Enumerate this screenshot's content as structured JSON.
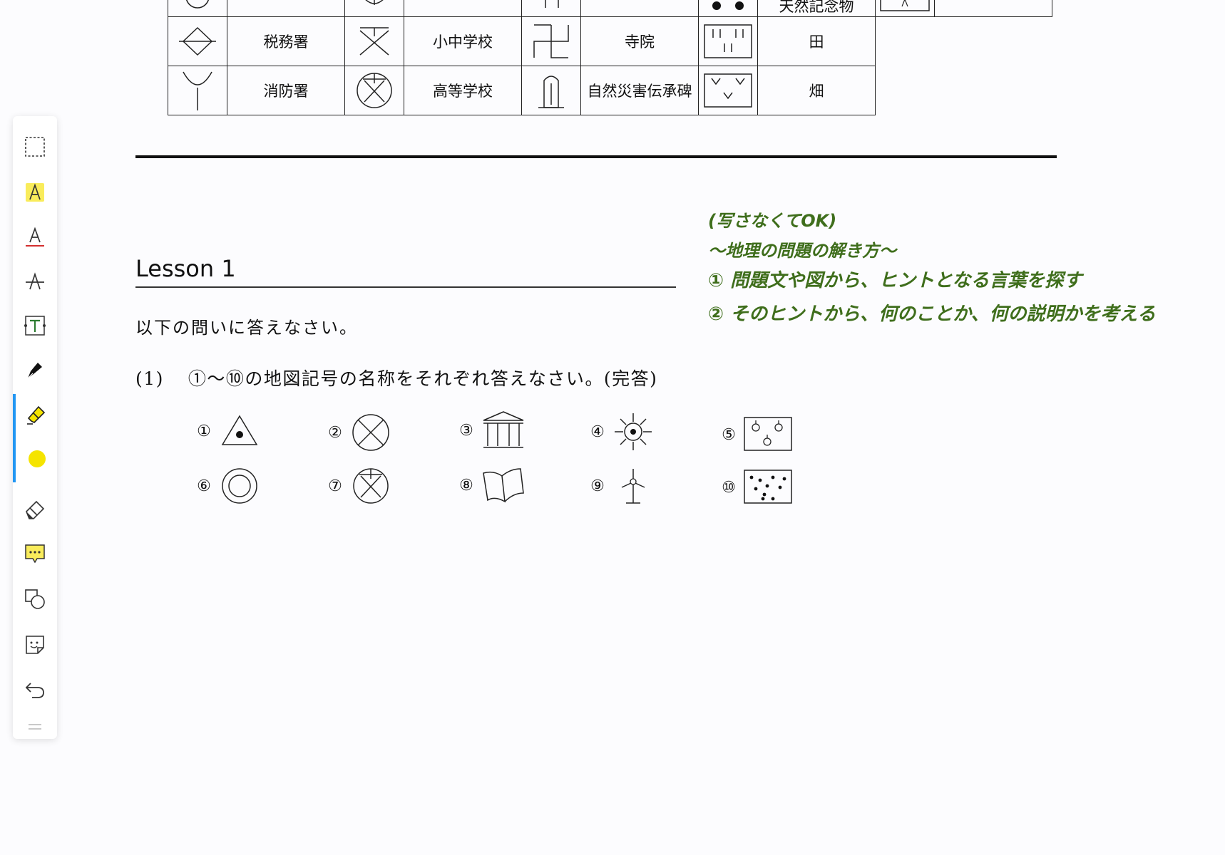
{
  "table": {
    "top_row": [
      "",
      "",
      "",
      "天然記念物",
      ""
    ],
    "rows": [
      {
        "names": [
          "税務署",
          "小中学校",
          "寺院",
          "田"
        ]
      },
      {
        "names": [
          "消防署",
          "高等学校",
          "自然災害伝承碑",
          "畑"
        ]
      }
    ]
  },
  "lesson": {
    "title": "Lesson 1",
    "instruction": "以下の問いに答えなさい。",
    "question_number": "(1)",
    "question_text": "①～⑩の地図記号の名称をそれぞれ答えなさい。(完答)"
  },
  "symbols": [
    {
      "num": "①",
      "icon": "triangle-dot-icon"
    },
    {
      "num": "②",
      "icon": "circle-x-icon"
    },
    {
      "num": "③",
      "icon": "museum-icon"
    },
    {
      "num": "④",
      "icon": "sun-rays-icon"
    },
    {
      "num": "⑤",
      "icon": "orchard-icon"
    },
    {
      "num": "⑥",
      "icon": "double-circle-icon"
    },
    {
      "num": "⑦",
      "icon": "circle-x-bar-icon"
    },
    {
      "num": "⑧",
      "icon": "open-book-icon"
    },
    {
      "num": "⑨",
      "icon": "windmill-icon"
    },
    {
      "num": "⑩",
      "icon": "dots-field-icon"
    }
  ],
  "notes": {
    "line1": "(写さなくてOK)",
    "line2": "～地理の問題の解き方～",
    "line3": "① 問題文や図から、ヒントとなる言葉を探す",
    "line4": "② そのヒントから、何のことか、何の説明かを考える",
    "color": "#3f6e1c"
  },
  "toolbar": {
    "tools": [
      "lasso-select-icon",
      "highlight-text-icon",
      "underline-text-icon",
      "strikethrough-text-icon",
      "text-box-icon",
      "pen-icon",
      "highlighter-icon",
      "color-yellow-icon",
      "eraser-icon",
      "comment-icon",
      "shapes-icon",
      "sticker-icon",
      "undo-icon"
    ],
    "active_tool": "highlighter-icon",
    "accent": "#2196f3",
    "highlight_color": "#f5e400"
  }
}
